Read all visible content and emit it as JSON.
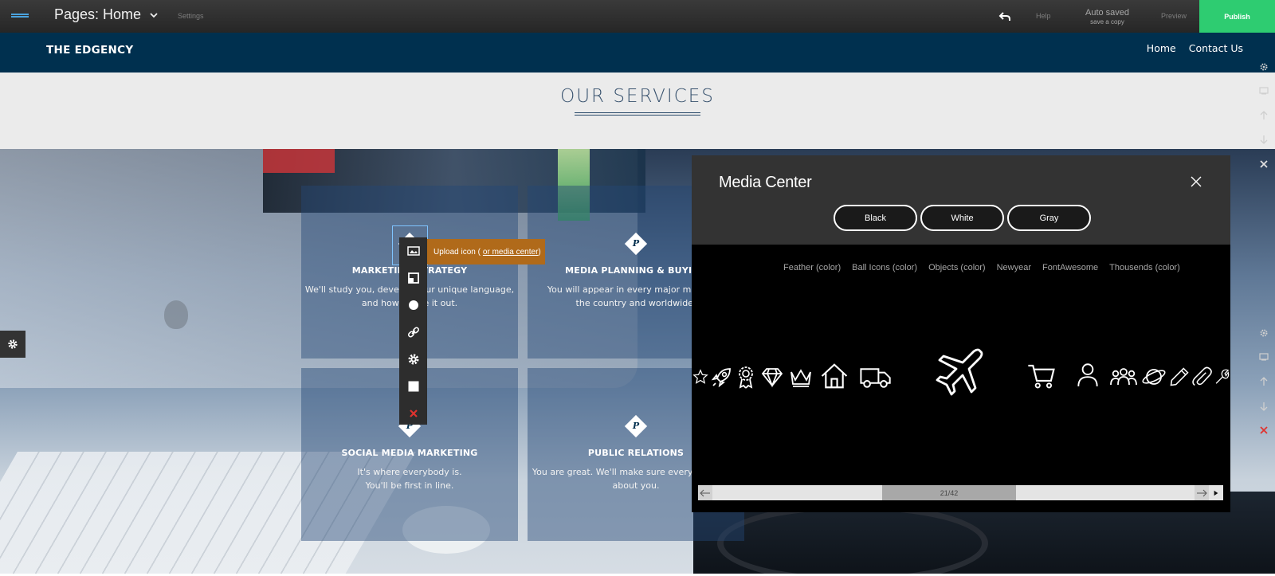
{
  "editor": {
    "page_selector": "Pages: Home",
    "settings": "Settings",
    "help": "Help",
    "autosaved": "Auto saved",
    "save_copy": "save a copy",
    "preview": "Preview",
    "publish": "Publish"
  },
  "site": {
    "logo": "THE EDGENCY",
    "nav": [
      "Home",
      "Contact Us"
    ]
  },
  "services": {
    "title": "OUR SERVICES",
    "cards": [
      {
        "badge": "P",
        "title": "MARKETING STRATEGY",
        "desc_line1": "We'll study you, develop your unique language,",
        "desc_line2": "and how to use it out."
      },
      {
        "badge": "P",
        "title": "MEDIA PLANNING & BUYING",
        "desc_line1": "You will appear in every major market in",
        "desc_line2": "the country and worldwide."
      },
      {
        "badge": "P",
        "title": "SOCIAL MEDIA MARKETING",
        "desc_line1": "It's where everybody is.",
        "desc_line2": "You'll be first in line."
      },
      {
        "badge": "P",
        "title": "PUBLIC RELATIONS",
        "desc_line1": "You are great. We'll make sure everyone knows",
        "desc_line2": "about you."
      }
    ]
  },
  "toolbar": {
    "upload_label": "Upload icon (",
    "media_center_link": "or media center",
    "upload_suffix": ")"
  },
  "media_center": {
    "title": "Media Center",
    "colors": [
      "Black",
      "White",
      "Gray"
    ],
    "categories": [
      "Feather (color)",
      "Ball Icons (color)",
      "Objects (color)",
      "Newyear",
      "FontAwesome",
      "Thousends (color)"
    ],
    "icons": [
      "star-icon",
      "rocket-icon",
      "award-icon",
      "diamond-icon",
      "crown-icon",
      "home-icon",
      "truck-icon",
      "airplane-icon",
      "cart-icon",
      "user-icon",
      "users-icon",
      "planet-icon",
      "pencil-icon",
      "paperclip-icon",
      "wrench-icon"
    ],
    "page_indicator": "21/42"
  },
  "colors": {
    "publish_green": "#2ecc71",
    "header_navy": "#00304f",
    "tooltip_orange": "#b06a1a"
  }
}
